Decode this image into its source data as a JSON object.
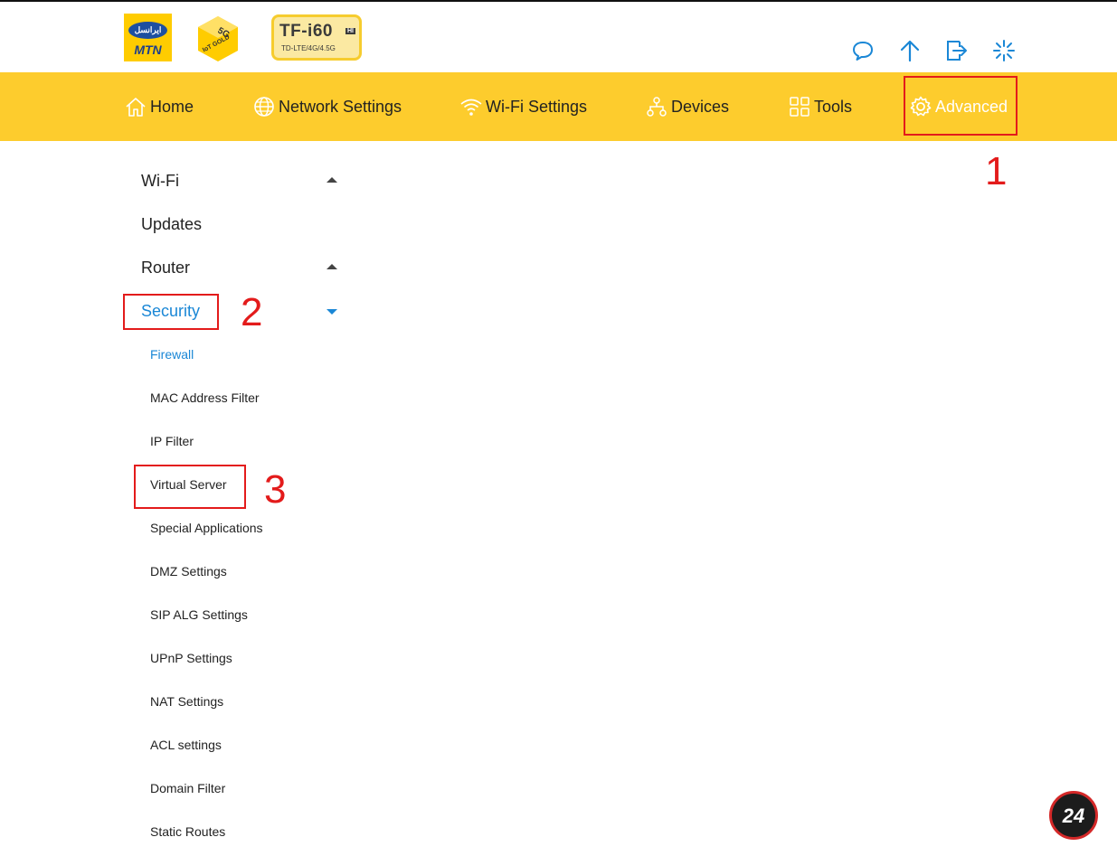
{
  "header": {
    "mtn_logo_text": "ایرانسل",
    "mtn_brand": "MTN",
    "badge_5g": "5G",
    "badge_iot": "IoT GOLD",
    "model_name": "TF-i60",
    "model_hi": "HI",
    "model_sub": "TD-LTE/4G/4.5G"
  },
  "toolbar": {
    "icons": [
      "chat-bubble-icon",
      "arrow-up-icon",
      "logout-icon",
      "loading-spinner-icon"
    ]
  },
  "nav": {
    "items": [
      {
        "label": "Home",
        "icon": "home-icon"
      },
      {
        "label": "Network Settings",
        "icon": "globe-icon"
      },
      {
        "label": "Wi-Fi Settings",
        "icon": "wifi-icon"
      },
      {
        "label": "Devices",
        "icon": "devices-tree-icon"
      },
      {
        "label": "Tools",
        "icon": "grid-icon"
      },
      {
        "label": "Advanced",
        "icon": "gear-icon",
        "active": true
      }
    ]
  },
  "sidebar": {
    "items": [
      {
        "label": "Wi-Fi",
        "level": "top",
        "arrow": "up"
      },
      {
        "label": "Updates",
        "level": "top"
      },
      {
        "label": "Router",
        "level": "top",
        "arrow": "up"
      },
      {
        "label": "Security",
        "level": "top",
        "arrow": "down",
        "selected": true
      },
      {
        "label": "Firewall",
        "level": "sub",
        "selected": true
      },
      {
        "label": "MAC Address Filter",
        "level": "sub"
      },
      {
        "label": "IP Filter",
        "level": "sub"
      },
      {
        "label": "Virtual Server",
        "level": "sub"
      },
      {
        "label": "Special Applications",
        "level": "sub"
      },
      {
        "label": "DMZ Settings",
        "level": "sub"
      },
      {
        "label": "SIP ALG Settings",
        "level": "sub"
      },
      {
        "label": "UPnP Settings",
        "level": "sub"
      },
      {
        "label": "NAT Settings",
        "level": "sub"
      },
      {
        "label": "ACL settings",
        "level": "sub"
      },
      {
        "label": "Domain Filter",
        "level": "sub"
      },
      {
        "label": "Static Routes",
        "level": "sub"
      }
    ]
  },
  "annotations": {
    "step1": "1",
    "step2": "2",
    "step3": "3"
  },
  "watermark": {
    "number": "24"
  },
  "colors": {
    "nav_bg": "#fdcc2d",
    "selected_text": "#1a87d6",
    "annotation_red": "#e31b1b",
    "icon_blue": "#1a87d6"
  }
}
